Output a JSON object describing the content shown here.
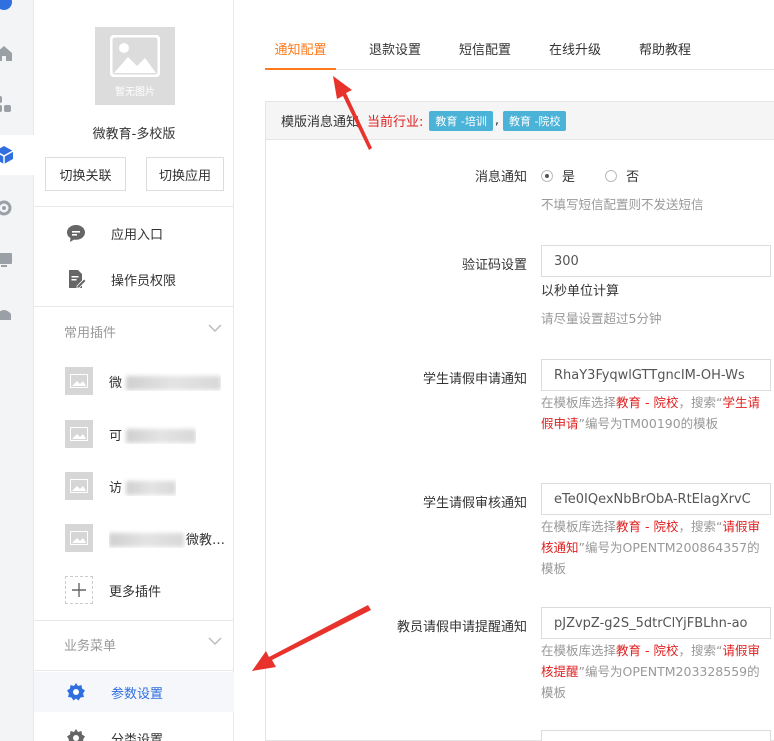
{
  "sidebar": {
    "logo_caption": "暂无图片",
    "app_name": "微教育-多校版",
    "switch_link_label": "切换关联",
    "switch_app_label": "切换应用",
    "menu": [
      {
        "label": "应用入口",
        "icon": "chat-bubble-icon"
      },
      {
        "label": "操作员权限",
        "icon": "document-edit-icon"
      }
    ],
    "common_plugins_title": "常用插件",
    "plugins": [
      {
        "label": "微",
        "icon": "image-placeholder-icon"
      },
      {
        "label": "可",
        "icon": "image-placeholder-icon"
      },
      {
        "label": "访",
        "icon": "image-placeholder-icon"
      },
      {
        "label": "微教…",
        "icon": "image-placeholder-icon"
      }
    ],
    "more_plugins_label": "更多插件",
    "business_menu_title": "业务菜单",
    "business_items": [
      {
        "label": "参数设置",
        "icon": "gear-icon"
      },
      {
        "label": "分类设置",
        "icon": "gear-icon"
      }
    ]
  },
  "tabs": [
    {
      "label": "通知配置",
      "active": true
    },
    {
      "label": "退款设置",
      "active": false
    },
    {
      "label": "短信配置",
      "active": false
    },
    {
      "label": "在线升级",
      "active": false
    },
    {
      "label": "帮助教程",
      "active": false
    }
  ],
  "panel": {
    "header_label": "模版消息通知",
    "industry_label": "当前行业:",
    "industry_badges": [
      "教育 -培训",
      "教育 -院校"
    ],
    "industry_separator": ",",
    "fields": {
      "message_notice": {
        "label": "消息通知",
        "options": [
          "是",
          "否"
        ],
        "selected": "是",
        "help": "不填写短信配置则不发送短信"
      },
      "verify_code": {
        "label": "验证码设置",
        "value": "300",
        "unit_note": "以秒单位计算",
        "help": "请尽量设置超过5分钟"
      },
      "student_leave_apply": {
        "label": "学生请假申请通知",
        "value": "RhaY3FyqwlGTTgncIM-OH-Ws",
        "help_prefix": "在模板库选择",
        "help_red1": "教育 - 院校",
        "help_mid": "，搜索“",
        "help_red2": "学生请假申请",
        "help_suffix": "”编号为TM00190的模板"
      },
      "student_leave_review": {
        "label": "学生请假审核通知",
        "value": "eTe0IQexNbBrObA-RtElagXrvC",
        "help_prefix": "在模板库选择",
        "help_red1": "教育 - 院校",
        "help_mid": "，搜索“",
        "help_red2": "请假审核通知",
        "help_suffix": "”编号为OPENTM200864357的模板"
      },
      "teacher_leave_remind": {
        "label": "教员请假申请提醒通知",
        "value": "pJZvpZ-g2S_5dtrClYjFBLhn-ao",
        "help_prefix": "在模板库选择",
        "help_red1": "教育 - 院校",
        "help_mid": "，搜索“",
        "help_red2": "请假审核提醒",
        "help_suffix": "”编号为OPENTM203328559的模板"
      }
    }
  },
  "colors": {
    "accent_orange": "#ff7a1a",
    "highlight_red": "#e02020",
    "badge_blue": "#4bb3d8",
    "active_blue": "#2f6fe0"
  }
}
